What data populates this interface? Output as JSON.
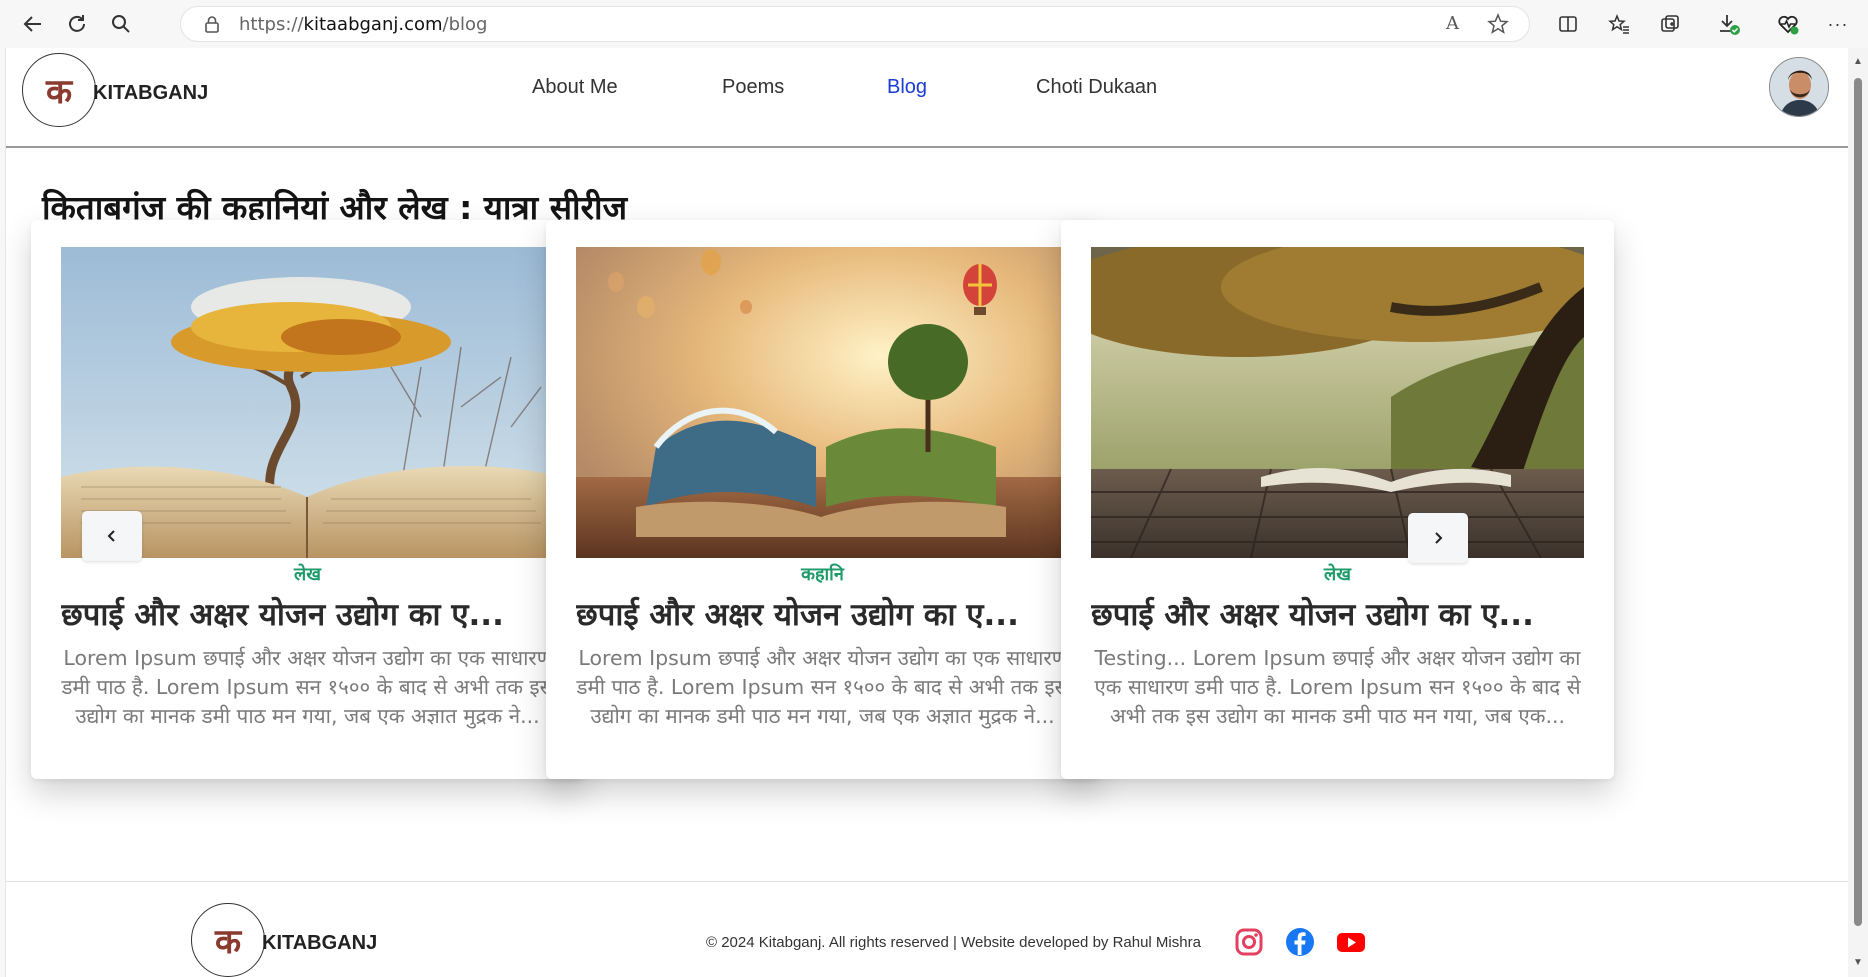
{
  "browser": {
    "url_prefix": "https://",
    "url_host": "kitaabganj.com",
    "url_path": "/blog",
    "read_aloud_label": "A",
    "more_label": "···"
  },
  "site": {
    "logo_letter": "क",
    "brand": "KITABGANJ",
    "nav": [
      {
        "label": "About Me",
        "active": false
      },
      {
        "label": "Poems",
        "active": false
      },
      {
        "label": "Blog",
        "active": true
      },
      {
        "label": "Choti Dukaan",
        "active": false
      }
    ]
  },
  "page": {
    "title": "किताबगंज की कहानियां और लेख : यात्रा सीरीज"
  },
  "cards": [
    {
      "category": "लेख",
      "title": "छपाई और अक्षर योजन उद्योग का ए...",
      "description": "Lorem Ipsum छपाई और अक्षर योजन उद्योग का एक साधारण डमी पाठ है. Lorem Ipsum सन १५०० के बाद से अभी तक इस उद्योग का मानक डमी पाठ मन गया, जब एक अज्ञात मुद्रक ने..."
    },
    {
      "category": "कहानि",
      "title": "छपाई और अक्षर योजन उद्योग का ए...",
      "description": "Lorem Ipsum छपाई और अक्षर योजन उद्योग का एक साधारण डमी पाठ है. Lorem Ipsum सन १५०० के बाद से अभी तक इस उद्योग का मानक डमी पाठ मन गया, जब एक अज्ञात मुद्रक ने..."
    },
    {
      "category": "लेख",
      "title": "छपाई और अक्षर योजन उद्योग का ए...",
      "description": "Testing... Lorem Ipsum छपाई और अक्षर योजन उद्योग का एक साधारण डमी पाठ है. Lorem Ipsum सन १५०० के बाद से अभी तक इस उद्योग का मानक डमी पाठ मन गया, जब एक..."
    }
  ],
  "carousel": {
    "prev_icon": "chevron-left-icon",
    "next_icon": "chevron-right-icon"
  },
  "footer": {
    "logo_letter": "क",
    "brand": "KITABGANJ",
    "copyright": "© 2024 Kitabganj. All rights reserved | Website developed by Rahul Mishra",
    "social": [
      "instagram-icon",
      "facebook-icon",
      "youtube-icon"
    ]
  },
  "colors": {
    "accent_link": "#1a3bd6",
    "category_green": "#1f9a6a",
    "logo_letter": "#8a3a2e",
    "instagram": "#e4405f",
    "facebook": "#1877f2",
    "youtube": "#ff0000"
  }
}
